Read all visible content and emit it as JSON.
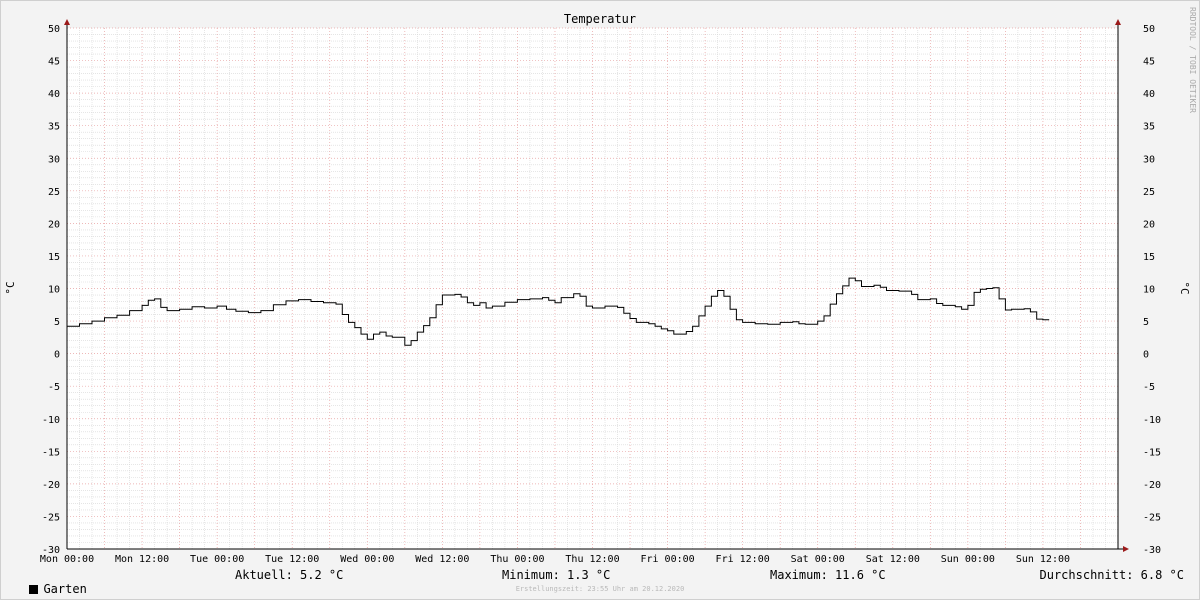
{
  "chart_data": {
    "type": "line",
    "title": "Temperatur",
    "ylabel": "°C",
    "ylim": [
      -30,
      50
    ],
    "y_ticks": [
      "50",
      "45",
      "40",
      "35",
      "30",
      "25",
      "20",
      "15",
      "10",
      "5",
      "0",
      "-5",
      "-10",
      "-15",
      "-20",
      "-25",
      "-30"
    ],
    "x_range_hours": [
      0,
      168
    ],
    "x_ticks": [
      {
        "hour": 0,
        "label": "Mon 00:00"
      },
      {
        "hour": 12,
        "label": "Mon 12:00"
      },
      {
        "hour": 24,
        "label": "Tue 00:00"
      },
      {
        "hour": 36,
        "label": "Tue 12:00"
      },
      {
        "hour": 48,
        "label": "Wed 00:00"
      },
      {
        "hour": 60,
        "label": "Wed 12:00"
      },
      {
        "hour": 72,
        "label": "Thu 00:00"
      },
      {
        "hour": 84,
        "label": "Thu 12:00"
      },
      {
        "hour": 96,
        "label": "Fri 00:00"
      },
      {
        "hour": 108,
        "label": "Fri 12:00"
      },
      {
        "hour": 120,
        "label": "Sat 00:00"
      },
      {
        "hour": 132,
        "label": "Sat 12:00"
      },
      {
        "hour": 144,
        "label": "Sun 00:00"
      },
      {
        "hour": 156,
        "label": "Sun 12:00"
      }
    ],
    "grid": true,
    "series": [
      {
        "name": "Garten",
        "color": "#000000",
        "points": [
          [
            0,
            4.2
          ],
          [
            2,
            4.6
          ],
          [
            4,
            5.0
          ],
          [
            6,
            5.5
          ],
          [
            8,
            5.9
          ],
          [
            10,
            6.6
          ],
          [
            12,
            7.4
          ],
          [
            13,
            8.2
          ],
          [
            14,
            8.4
          ],
          [
            15,
            7.1
          ],
          [
            16,
            6.6
          ],
          [
            18,
            6.8
          ],
          [
            20,
            7.2
          ],
          [
            22,
            7.0
          ],
          [
            24,
            7.3
          ],
          [
            25.5,
            6.8
          ],
          [
            27,
            6.5
          ],
          [
            29,
            6.3
          ],
          [
            31,
            6.6
          ],
          [
            33,
            7.5
          ],
          [
            35,
            8.1
          ],
          [
            37,
            8.3
          ],
          [
            39,
            8.0
          ],
          [
            41,
            7.8
          ],
          [
            43,
            7.6
          ],
          [
            44,
            6.0
          ],
          [
            45,
            4.8
          ],
          [
            46,
            4.0
          ],
          [
            47,
            3.0
          ],
          [
            48,
            2.2
          ],
          [
            49,
            3.0
          ],
          [
            50,
            3.3
          ],
          [
            51,
            2.7
          ],
          [
            52,
            2.5
          ],
          [
            54,
            1.3
          ],
          [
            55,
            2.0
          ],
          [
            56,
            3.3
          ],
          [
            57,
            4.3
          ],
          [
            58,
            5.5
          ],
          [
            59,
            7.5
          ],
          [
            60,
            9.0
          ],
          [
            62,
            9.1
          ],
          [
            63,
            8.7
          ],
          [
            64,
            7.8
          ],
          [
            65,
            7.4
          ],
          [
            66,
            7.8
          ],
          [
            67,
            7.0
          ],
          [
            68,
            7.3
          ],
          [
            70,
            7.9
          ],
          [
            72,
            8.3
          ],
          [
            74,
            8.4
          ],
          [
            76,
            8.6
          ],
          [
            77,
            8.2
          ],
          [
            78,
            7.8
          ],
          [
            79,
            8.6
          ],
          [
            81,
            9.2
          ],
          [
            82,
            8.8
          ],
          [
            83,
            7.3
          ],
          [
            84,
            7.0
          ],
          [
            86,
            7.3
          ],
          [
            88,
            7.1
          ],
          [
            89,
            6.2
          ],
          [
            90,
            5.4
          ],
          [
            91,
            4.8
          ],
          [
            93,
            4.6
          ],
          [
            94,
            4.2
          ],
          [
            95,
            3.8
          ],
          [
            96,
            3.5
          ],
          [
            97,
            3.0
          ],
          [
            99,
            3.4
          ],
          [
            100,
            4.2
          ],
          [
            101,
            5.8
          ],
          [
            102,
            7.3
          ],
          [
            103,
            8.8
          ],
          [
            104,
            9.7
          ],
          [
            105,
            8.8
          ],
          [
            106,
            6.8
          ],
          [
            107,
            5.2
          ],
          [
            108,
            4.8
          ],
          [
            110,
            4.6
          ],
          [
            112,
            4.5
          ],
          [
            114,
            4.8
          ],
          [
            116,
            4.9
          ],
          [
            117,
            4.6
          ],
          [
            118,
            4.5
          ],
          [
            120,
            5.0
          ],
          [
            121,
            5.8
          ],
          [
            122,
            7.6
          ],
          [
            123,
            9.2
          ],
          [
            124,
            10.4
          ],
          [
            125,
            11.6
          ],
          [
            126,
            11.2
          ],
          [
            127,
            10.3
          ],
          [
            128,
            10.3
          ],
          [
            129,
            10.5
          ],
          [
            130,
            10.2
          ],
          [
            131,
            9.7
          ],
          [
            133,
            9.6
          ],
          [
            135,
            9.1
          ],
          [
            136,
            8.3
          ],
          [
            138,
            8.4
          ],
          [
            139,
            7.7
          ],
          [
            140,
            7.4
          ],
          [
            142,
            7.2
          ],
          [
            143,
            6.8
          ],
          [
            144,
            7.4
          ],
          [
            145,
            9.4
          ],
          [
            146,
            9.9
          ],
          [
            147,
            10.0
          ],
          [
            148,
            10.1
          ],
          [
            149,
            8.4
          ],
          [
            150,
            6.7
          ],
          [
            151,
            6.8
          ],
          [
            153,
            6.9
          ],
          [
            154,
            6.4
          ],
          [
            155,
            5.3
          ],
          [
            156,
            5.2
          ],
          [
            157,
            5.2
          ]
        ]
      }
    ]
  },
  "watermark": "RRDTOOL / TOBI OETIKER",
  "legend": {
    "series_name": "Garten",
    "current": "Aktuell: 5.2 °C",
    "minimum": "Minimum: 1.3 °C",
    "maximum": "Maximum: 11.6 °C",
    "average": "Durchschnitt: 6.8 °C"
  },
  "footer": "Erstellungszeit: 23:55 Uhr am 20.12.2020"
}
